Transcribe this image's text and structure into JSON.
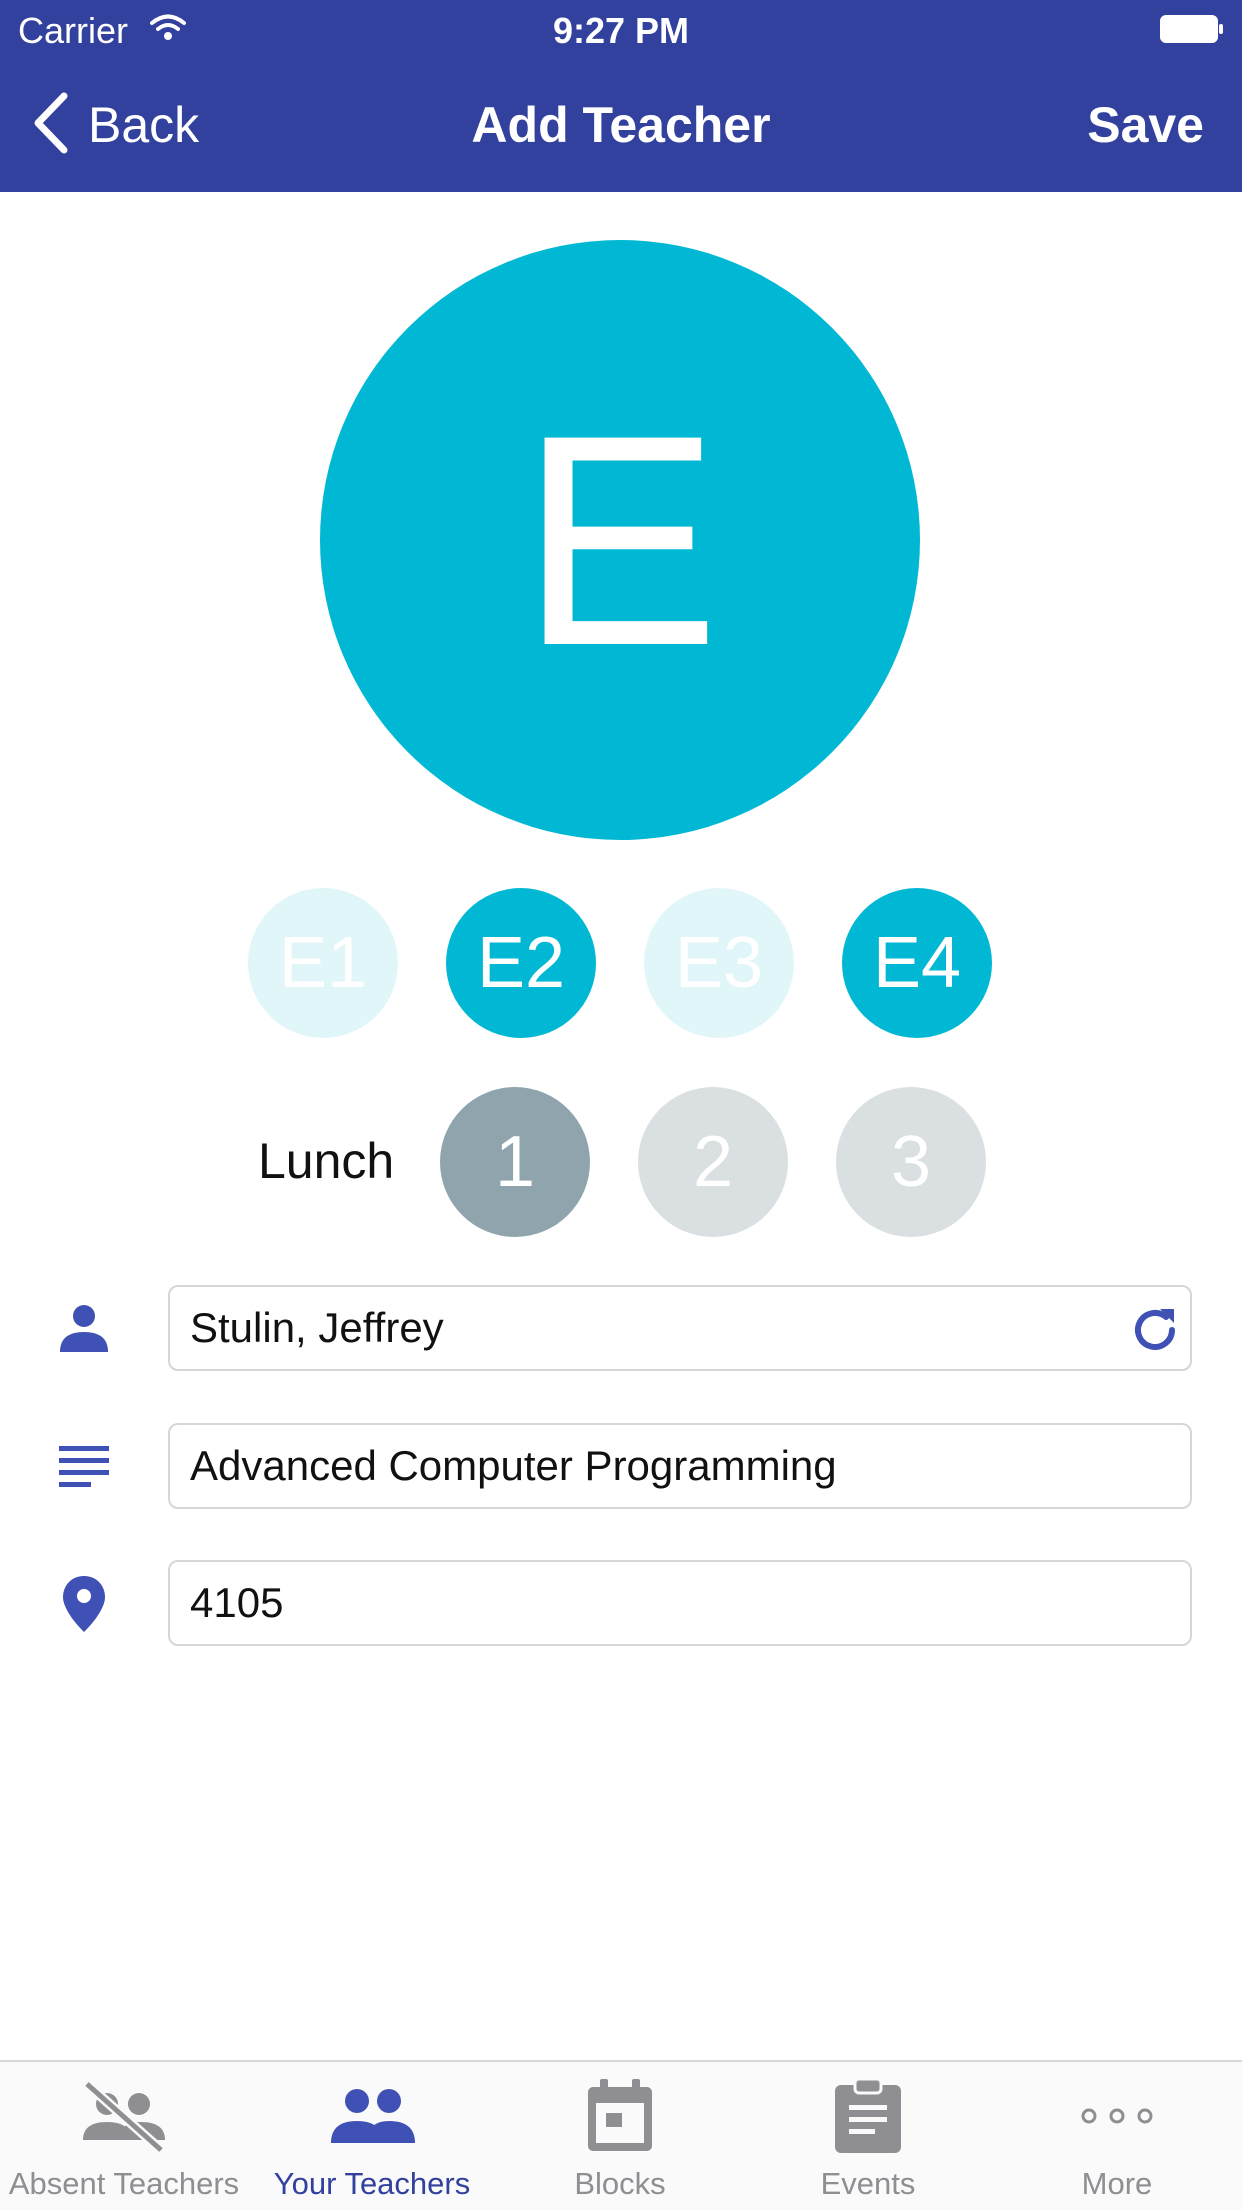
{
  "status": {
    "carrier": "Carrier",
    "time": "9:27 PM"
  },
  "nav": {
    "back": "Back",
    "title": "Add Teacher",
    "save": "Save"
  },
  "avatar": {
    "letter": "E",
    "color": "#00b8d4"
  },
  "blocks": [
    {
      "label": "E1",
      "selected": false
    },
    {
      "label": "E2",
      "selected": true
    },
    {
      "label": "E3",
      "selected": false
    },
    {
      "label": "E4",
      "selected": true
    }
  ],
  "lunch": {
    "label": "Lunch",
    "options": [
      {
        "label": "1",
        "selected": true
      },
      {
        "label": "2",
        "selected": false
      },
      {
        "label": "3",
        "selected": false
      }
    ]
  },
  "form": {
    "name": {
      "icon": "person-icon",
      "value": "Stulin, Jeffrey"
    },
    "course": {
      "icon": "lines-icon",
      "value": "Advanced Computer Programming"
    },
    "room": {
      "icon": "location-pin-icon",
      "value": "4105"
    }
  },
  "tabs": [
    {
      "label": "Absent Teachers",
      "icon": "absent-teachers-icon",
      "active": false
    },
    {
      "label": "Your Teachers",
      "icon": "your-teachers-icon",
      "active": true
    },
    {
      "label": "Blocks",
      "icon": "calendar-icon",
      "active": false
    },
    {
      "label": "Events",
      "icon": "clipboard-icon",
      "active": false
    },
    {
      "label": "More",
      "icon": "more-icon",
      "active": false
    }
  ],
  "colors": {
    "primary": "#32409e",
    "accent": "#00b8d4",
    "lunch_selected": "#90a4ae"
  }
}
